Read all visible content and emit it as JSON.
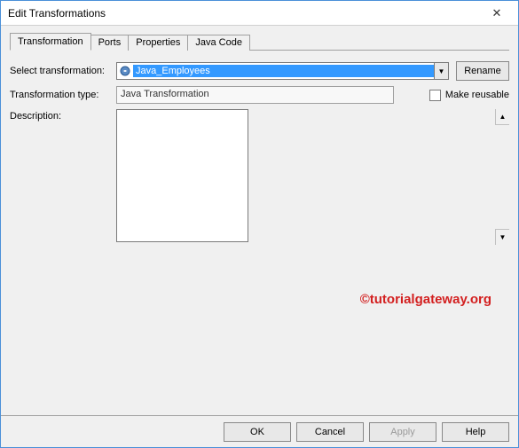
{
  "window": {
    "title": "Edit Transformations"
  },
  "tabs": [
    {
      "label": "Transformation"
    },
    {
      "label": "Ports"
    },
    {
      "label": "Properties"
    },
    {
      "label": "Java Code"
    }
  ],
  "form": {
    "select_label": "Select transformation:",
    "select_value": "Java_Employees",
    "rename_label": "Rename",
    "type_label": "Transformation type:",
    "type_value": "Java Transformation",
    "reusable_label": "Make reusable",
    "desc_label": "Description:"
  },
  "buttons": {
    "ok": "OK",
    "cancel": "Cancel",
    "apply": "Apply",
    "help": "Help"
  },
  "watermark": "©tutorialgateway.org"
}
